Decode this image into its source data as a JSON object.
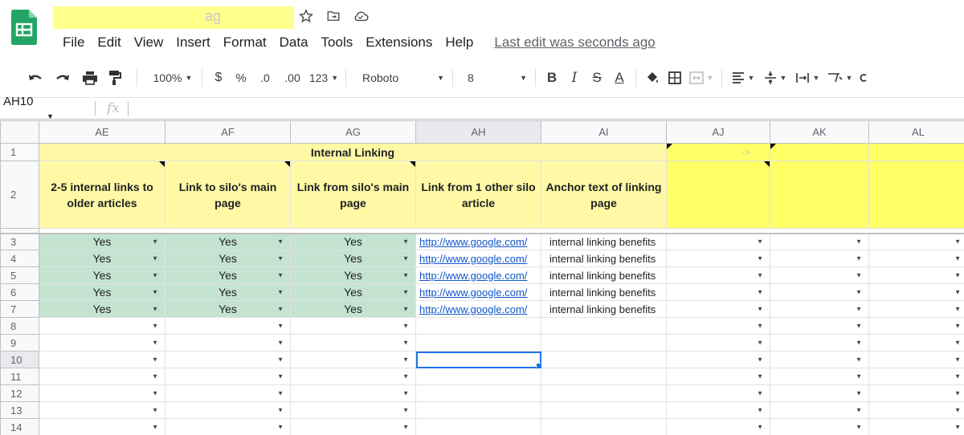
{
  "app": {
    "title": "ag",
    "last_edit": "Last edit was seconds ago",
    "menu": [
      "File",
      "Edit",
      "View",
      "Insert",
      "Format",
      "Data",
      "Tools",
      "Extensions",
      "Help"
    ]
  },
  "toolbar": {
    "zoom": "100%",
    "currency": "$",
    "percent": "%",
    "dec_less": ".0",
    "dec_more": ".00",
    "more_formats": "123",
    "font": "Roboto",
    "font_size": "8",
    "bold": "B",
    "italic": "I",
    "strike": "S",
    "text_color": "A"
  },
  "formula_bar": {
    "cell_ref": "AH10",
    "fx": "fx"
  },
  "columns": [
    "AE",
    "AF",
    "AG",
    "AH",
    "AI",
    "AJ",
    "AK",
    "AL"
  ],
  "rows": [
    "1",
    "2",
    "3",
    "4",
    "5",
    "6",
    "7",
    "8",
    "9",
    "10",
    "11",
    "12",
    "13",
    "14"
  ],
  "sheet": {
    "merged_title": "Internal Linking",
    "aj_note": "->",
    "headers": {
      "ae": "2-5 internal links to older articles",
      "af": "Link to silo's main page",
      "ag": "Link from silo's main page",
      "ah": "Link from 1 other silo article",
      "ai": "Anchor text of linking page"
    },
    "data_rows": [
      {
        "ae": "Yes",
        "af": "Yes",
        "ag": "Yes",
        "ah": "http://www.google.com/",
        "ai": "internal linking benefits"
      },
      {
        "ae": "Yes",
        "af": "Yes",
        "ag": "Yes",
        "ah": "http://www.google.com/",
        "ai": "internal linking benefits"
      },
      {
        "ae": "Yes",
        "af": "Yes",
        "ag": "Yes",
        "ah": "http://www.google.com/",
        "ai": "internal linking benefits"
      },
      {
        "ae": "Yes",
        "af": "Yes",
        "ag": "Yes",
        "ah": "http://www.google.com/",
        "ai": "internal linking benefits"
      },
      {
        "ae": "Yes",
        "af": "Yes",
        "ag": "Yes",
        "ah": "http://www.google.com/",
        "ai": "internal linking benefits"
      }
    ]
  },
  "colors": {
    "header_yellow": "#fff9a6",
    "highlight_yellow": "#ffff66",
    "yes_green": "#c4e3d1",
    "link_blue": "#1155cc",
    "selection_blue": "#1a73e8"
  },
  "selected_cell": "AH10"
}
